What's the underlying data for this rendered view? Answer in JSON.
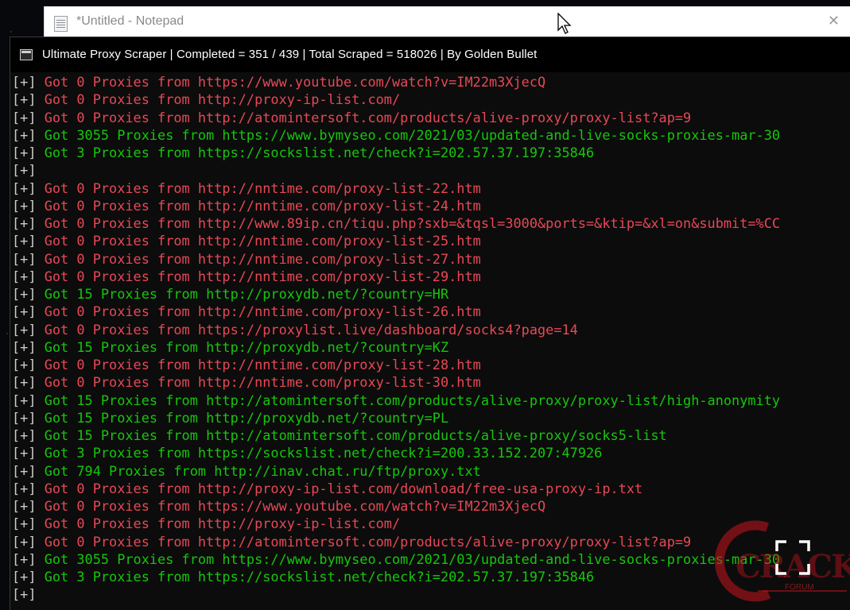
{
  "notepad": {
    "title": "*Untitled - Notepad",
    "close_glyph": "✕"
  },
  "console": {
    "title": "Ultimate Proxy Scraper | Completed = 351 / 439 | Total Scraped = 518026 | By Golden Bullet",
    "prefix": "[+]",
    "lines": [
      {
        "text": "Got 0 Proxies from https://www.youtube.com/watch?v=IM22m3XjecQ",
        "status": "red"
      },
      {
        "text": "Got 0 Proxies from http://proxy-ip-list.com/",
        "status": "red"
      },
      {
        "text": "Got 0 Proxies from http://atomintersoft.com/products/alive-proxy/proxy-list?ap=9",
        "status": "red"
      },
      {
        "text": "Got 3055 Proxies from https://www.bymyseo.com/2021/03/updated-and-live-socks-proxies-mar-30",
        "status": "green"
      },
      {
        "text": "Got 3 Proxies from https://sockslist.net/check?i=202.57.37.197:35846",
        "status": "green"
      },
      {
        "text": "",
        "status": "none"
      },
      {
        "text": "Got 0 Proxies from http://nntime.com/proxy-list-22.htm",
        "status": "red"
      },
      {
        "text": "Got 0 Proxies from http://nntime.com/proxy-list-24.htm",
        "status": "red"
      },
      {
        "text": "Got 0 Proxies from http://www.89ip.cn/tiqu.php?sxb=&tqsl=3000&ports=&ktip=&xl=on&submit=%CC",
        "status": "red"
      },
      {
        "text": "Got 0 Proxies from http://nntime.com/proxy-list-25.htm",
        "status": "red"
      },
      {
        "text": "Got 0 Proxies from http://nntime.com/proxy-list-27.htm",
        "status": "red"
      },
      {
        "text": "Got 0 Proxies from http://nntime.com/proxy-list-29.htm",
        "status": "red"
      },
      {
        "text": "Got 15 Proxies from http://proxydb.net/?country=HR",
        "status": "green"
      },
      {
        "text": "Got 0 Proxies from http://nntime.com/proxy-list-26.htm",
        "status": "red"
      },
      {
        "text": "Got 0 Proxies from https://proxylist.live/dashboard/socks4?page=14",
        "status": "red"
      },
      {
        "text": "Got 15 Proxies from http://proxydb.net/?country=KZ",
        "status": "green"
      },
      {
        "text": "Got 0 Proxies from http://nntime.com/proxy-list-28.htm",
        "status": "red"
      },
      {
        "text": "Got 0 Proxies from http://nntime.com/proxy-list-30.htm",
        "status": "red"
      },
      {
        "text": "Got 15 Proxies from http://atomintersoft.com/products/alive-proxy/proxy-list/high-anonymity",
        "status": "green"
      },
      {
        "text": "Got 15 Proxies from http://proxydb.net/?country=PL",
        "status": "green"
      },
      {
        "text": "Got 15 Proxies from http://atomintersoft.com/products/alive-proxy/socks5-list",
        "status": "green"
      },
      {
        "text": "Got 3 Proxies from https://sockslist.net/check?i=200.33.152.207:47926",
        "status": "green"
      },
      {
        "text": "Got 794 Proxies from http://inav.chat.ru/ftp/proxy.txt",
        "status": "green"
      },
      {
        "text": "Got 0 Proxies from http://proxy-ip-list.com/download/free-usa-proxy-ip.txt",
        "status": "red"
      },
      {
        "text": "Got 0 Proxies from https://www.youtube.com/watch?v=IM22m3XjecQ",
        "status": "red"
      },
      {
        "text": "Got 0 Proxies from http://proxy-ip-list.com/",
        "status": "red"
      },
      {
        "text": "Got 0 Proxies from http://atomintersoft.com/products/alive-proxy/proxy-list?ap=9",
        "status": "red"
      },
      {
        "text": "Got 3055 Proxies from https://www.bymyseo.com/2021/03/updated-and-live-socks-proxies-mar-30",
        "status": "green"
      },
      {
        "text": "Got 3 Proxies from https://sockslist.net/check?i=202.57.37.197:35846",
        "status": "green"
      },
      {
        "text": "",
        "status": "none"
      }
    ]
  },
  "colors": {
    "console_bg": "#0c0c0c",
    "fail": "#e74856",
    "success": "#16c60c",
    "prefix": "#cccccc"
  },
  "watermark": {
    "text": "CRACK",
    "sub": "FORUM"
  },
  "icons": {
    "fullscreen": "fullscreen-icon",
    "cursor": "mouse-cursor-icon"
  }
}
